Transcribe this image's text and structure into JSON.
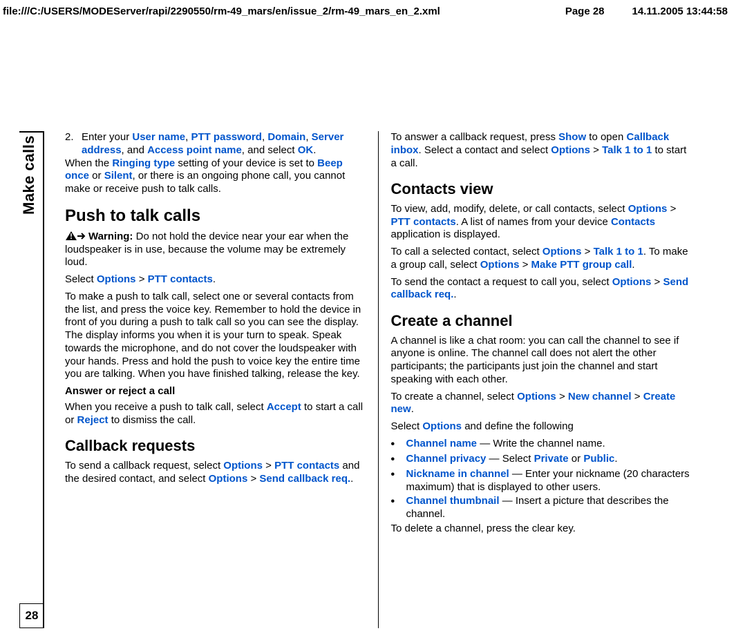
{
  "header": {
    "path": "file:///C:/USERS/MODEServer/rapi/2290550/rm-49_mars/en/issue_2/rm-49_mars_en_2.xml",
    "page": "Page 28",
    "timestamp": "14.11.2005 13:44:58"
  },
  "side_tab": "Make calls",
  "page_number": "28",
  "left": {
    "step_num": "2.",
    "step_txt_a": "Enter your ",
    "user_name": "User name",
    "comma1": ", ",
    "ptt_password": "PTT password",
    "comma2": ", ",
    "domain": "Domain",
    "comma3": ", ",
    "server_address": "Server address",
    "and1": ", and ",
    "apn": "Access point name",
    "and_select": ", and select ",
    "ok": "OK",
    "period1": ".",
    "when_the": "When the ",
    "ringing_type": "Ringing type",
    "ringing_mid": " setting of your device is set to ",
    "beep_once": "Beep once",
    "or": " or ",
    "silent": "Silent",
    "ringing_end": ", or there is an ongoing phone call, you cannot make or receive push to talk calls.",
    "h_ptt_calls": "Push to talk calls",
    "warning_label": "Warning:  ",
    "warning_text": "Do not hold the device near your ear when the loudspeaker is in use, because the volume may be extremely loud.",
    "select": "Select ",
    "options": "Options",
    "gt": " > ",
    "ptt_contacts": " PTT contacts",
    "period2": ".",
    "ptt_call_para": "To make a push to talk call, select one or several contacts from the list, and press the voice key. Remember to hold the device in front of you during a push to talk call so you can see the display. The display informs you when it is your turn to speak. Speak towards the microphone, and do not cover the loudspeaker with your hands. Press and hold the push to voice key the entire time you are talking. When you have finished talking, release the key.",
    "answer_reject_h": "Answer or reject a call",
    "answer_a": "When you receive a push to talk call, select ",
    "accept": "Accept",
    "answer_b": " to start a call or ",
    "reject": "Reject",
    "answer_c": " to dismiss the call.",
    "h_callback": "Callback requests",
    "cb_a": "To send a callback request, select ",
    "cb_b": " and the desired contact, and select ",
    "send_cb_req": "Send callback req.",
    "period3": "."
  },
  "right": {
    "answer_cb_a": "To answer a callback request, press ",
    "show": "Show",
    "answer_cb_b": " to open ",
    "callback_inbox": "Callback inbox",
    "answer_cb_c": ". Select a contact and select ",
    "options": "Options",
    "gt": " > ",
    "talk_1_to_1": "Talk 1 to 1",
    "answer_cb_d": " to start a call.",
    "h_contacts_view": "Contacts view",
    "cv_a": "To view, add, modify, delete, or call contacts, select ",
    "ptt_contacts": " PTT contacts",
    "cv_b": ". A list of names from your device ",
    "contacts": "Contacts",
    "cv_c": " application is displayed.",
    "call_sel_a": "To call a selected contact, select ",
    "talk_1_to_1_b": " Talk 1 to 1",
    "call_sel_b": ". To make a group call, select ",
    "make_ptt_group": " Make PTT group call",
    "period1": ".",
    "send_contact_a": "To send the contact a request to call you, select ",
    "send_cb_req": " Send callback req.",
    "period2": ".",
    "h_create_channel": "Create a channel",
    "channel_desc": "A channel is like a chat room: you can call the channel to see if anyone is online. The channel call does not alert the other participants; the participants just join the channel and start speaking with each other.",
    "create_ch_a": "To create a channel, select ",
    "new_channel": " New channel",
    "create_new": "Create new",
    "period3": ".",
    "select_opts_define": "Select ",
    "define_following": " and define the following",
    "channel_name": "Channel name",
    "channel_name_desc": "  — Write the channel name.",
    "channel_privacy": "Channel privacy",
    "channel_privacy_a": "  — Select ",
    "private": "Private",
    "or": " or ",
    "public": "Public",
    "period4": ".",
    "nickname": "Nickname in channel",
    "nickname_desc": "  — Enter your nickname (20 characters maximum) that is displayed to other users.",
    "thumbnail": "Channel thumbnail",
    "thumbnail_desc": "  — Insert a picture that describes the channel.",
    "delete_channel": "To delete a channel, press the clear key."
  }
}
